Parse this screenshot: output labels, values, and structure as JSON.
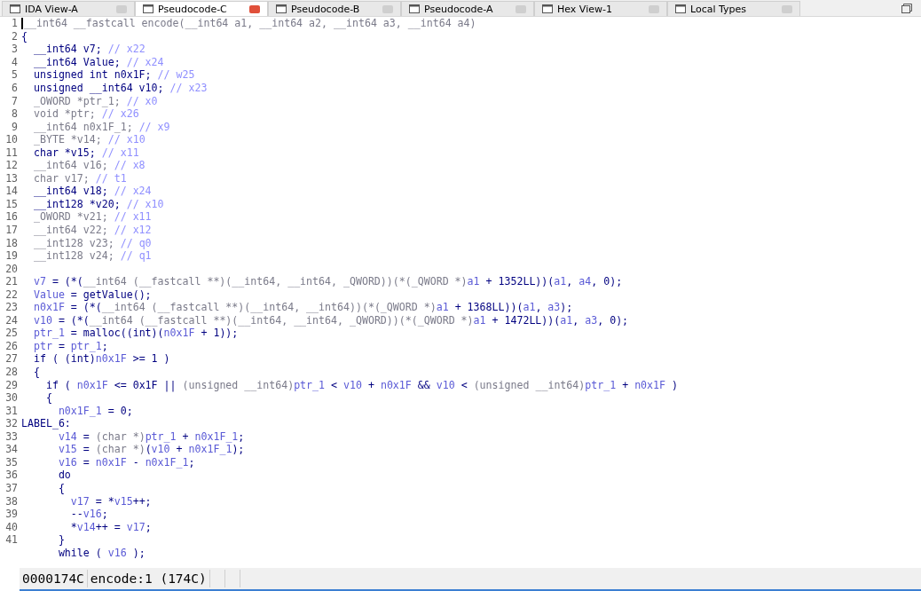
{
  "tabs": [
    {
      "label": "IDA View-A",
      "selected": false
    },
    {
      "label": "Pseudocode-C",
      "selected": true
    },
    {
      "label": "Pseudocode-B",
      "selected": false
    },
    {
      "label": "Pseudocode-A",
      "selected": false
    },
    {
      "label": "Hex View-1",
      "selected": false
    },
    {
      "label": "Local Types",
      "selected": false
    }
  ],
  "code_lines": [
    {
      "number": "1",
      "tokens": [
        {
          "text": "__int64 __fastcall encode(__int64 a1, __int64 a2, __int64 a3, __int64 a4)",
          "kind": "gray"
        }
      ]
    },
    {
      "number": "2",
      "tokens": [
        {
          "text": "{",
          "kind": "code"
        }
      ]
    },
    {
      "number": "3",
      "tokens": [
        {
          "text": "  __int64 v7; ",
          "kind": "code"
        },
        {
          "text": "// x22",
          "kind": "comment"
        }
      ]
    },
    {
      "number": "4",
      "tokens": [
        {
          "text": "  __int64 Value; ",
          "kind": "code"
        },
        {
          "text": "// x24",
          "kind": "comment"
        }
      ]
    },
    {
      "number": "5",
      "tokens": [
        {
          "text": "  unsigned int n0x1F; ",
          "kind": "code"
        },
        {
          "text": "// w25",
          "kind": "comment"
        }
      ]
    },
    {
      "number": "6",
      "tokens": [
        {
          "text": "  unsigned __int64 v10; ",
          "kind": "code"
        },
        {
          "text": "// x23",
          "kind": "comment"
        }
      ]
    },
    {
      "number": "7",
      "tokens": [
        {
          "text": "  _OWORD *ptr_1; ",
          "kind": "gray"
        },
        {
          "text": "// x0",
          "kind": "comment"
        }
      ]
    },
    {
      "number": "8",
      "tokens": [
        {
          "text": "  void *ptr; ",
          "kind": "gray"
        },
        {
          "text": "// x26",
          "kind": "comment"
        }
      ]
    },
    {
      "number": "9",
      "tokens": [
        {
          "text": "  __int64 n0x1F_1; ",
          "kind": "gray"
        },
        {
          "text": "// x9",
          "kind": "comment"
        }
      ]
    },
    {
      "number": "10",
      "tokens": [
        {
          "text": "  _BYTE *v14; ",
          "kind": "gray"
        },
        {
          "text": "// x10",
          "kind": "comment"
        }
      ]
    },
    {
      "number": "11",
      "tokens": [
        {
          "text": "  char *v15; ",
          "kind": "code"
        },
        {
          "text": "// x11",
          "kind": "comment"
        }
      ]
    },
    {
      "number": "12",
      "tokens": [
        {
          "text": "  __int64 v16; ",
          "kind": "gray"
        },
        {
          "text": "// x8",
          "kind": "comment"
        }
      ]
    },
    {
      "number": "13",
      "tokens": [
        {
          "text": "  char v17; ",
          "kind": "gray"
        },
        {
          "text": "// t1",
          "kind": "comment"
        }
      ]
    },
    {
      "number": "14",
      "tokens": [
        {
          "text": "  __int64 v18; ",
          "kind": "code"
        },
        {
          "text": "// x24",
          "kind": "comment"
        }
      ]
    },
    {
      "number": "15",
      "tokens": [
        {
          "text": "  __int128 *v20; ",
          "kind": "code"
        },
        {
          "text": "// x10",
          "kind": "comment"
        }
      ]
    },
    {
      "number": "16",
      "tokens": [
        {
          "text": "  _OWORD *v21; ",
          "kind": "gray"
        },
        {
          "text": "// x11",
          "kind": "comment"
        }
      ]
    },
    {
      "number": "17",
      "tokens": [
        {
          "text": "  __int64 v22; ",
          "kind": "gray"
        },
        {
          "text": "// x12",
          "kind": "comment"
        }
      ]
    },
    {
      "number": "18",
      "tokens": [
        {
          "text": "  __int128 v23; ",
          "kind": "gray"
        },
        {
          "text": "// q0",
          "kind": "comment"
        }
      ]
    },
    {
      "number": "19",
      "tokens": [
        {
          "text": "  __int128 v24; ",
          "kind": "gray"
        },
        {
          "text": "// q1",
          "kind": "comment"
        }
      ]
    },
    {
      "number": "20"
    },
    {
      "number": "21",
      "tokens": [
        {
          "text": "  v7",
          "kind": "var"
        },
        {
          "text": " = (*(",
          "kind": "code"
        },
        {
          "text": "__int64 (__fastcall **)(__int64, __int64, _QWORD))(*(_QWORD *)",
          "kind": "gray"
        },
        {
          "text": "a1",
          "kind": "var"
        },
        {
          "text": " + 1352LL))(",
          "kind": "code"
        },
        {
          "text": "a1",
          "kind": "var"
        },
        {
          "text": ", ",
          "kind": "code"
        },
        {
          "text": "a4",
          "kind": "var"
        },
        {
          "text": ", 0);",
          "kind": "code"
        }
      ]
    },
    {
      "number": "22",
      "tokens": [
        {
          "text": "  Value",
          "kind": "var"
        },
        {
          "text": " = getValue();",
          "kind": "code"
        }
      ]
    },
    {
      "number": "23",
      "tokens": [
        {
          "text": "  n0x1F",
          "kind": "var"
        },
        {
          "text": " = (*(",
          "kind": "code"
        },
        {
          "text": "__int64 (__fastcall **)(__int64, __int64))(*(_QWORD *)",
          "kind": "gray"
        },
        {
          "text": "a1",
          "kind": "var"
        },
        {
          "text": " + 1368LL))(",
          "kind": "code"
        },
        {
          "text": "a1",
          "kind": "var"
        },
        {
          "text": ", ",
          "kind": "code"
        },
        {
          "text": "a3",
          "kind": "var"
        },
        {
          "text": ");",
          "kind": "code"
        }
      ]
    },
    {
      "number": "24",
      "tokens": [
        {
          "text": "  v10",
          "kind": "var"
        },
        {
          "text": " = (*(",
          "kind": "code"
        },
        {
          "text": "__int64 (__fastcall **)(__int64, __int64, _QWORD))(*(_QWORD *)",
          "kind": "gray"
        },
        {
          "text": "a1",
          "kind": "var"
        },
        {
          "text": " + 1472LL))(",
          "kind": "code"
        },
        {
          "text": "a1",
          "kind": "var"
        },
        {
          "text": ", ",
          "kind": "code"
        },
        {
          "text": "a3",
          "kind": "var"
        },
        {
          "text": ", 0);",
          "kind": "code"
        }
      ]
    },
    {
      "number": "25",
      "tokens": [
        {
          "text": "  ptr_1",
          "kind": "var"
        },
        {
          "text": " = malloc((int)(",
          "kind": "code"
        },
        {
          "text": "n0x1F",
          "kind": "var"
        },
        {
          "text": " + 1));",
          "kind": "code"
        }
      ]
    },
    {
      "number": "26",
      "tokens": [
        {
          "text": "  ptr",
          "kind": "var"
        },
        {
          "text": " = ",
          "kind": "code"
        },
        {
          "text": "ptr_1",
          "kind": "var"
        },
        {
          "text": ";",
          "kind": "code"
        }
      ]
    },
    {
      "number": "27",
      "tokens": [
        {
          "text": "  if ( (int)",
          "kind": "code"
        },
        {
          "text": "n0x1F",
          "kind": "var"
        },
        {
          "text": " >= 1 )",
          "kind": "code"
        }
      ]
    },
    {
      "number": "28",
      "tokens": [
        {
          "text": "  {",
          "kind": "code"
        }
      ]
    },
    {
      "number": "29",
      "tokens": [
        {
          "text": "    if ( ",
          "kind": "code"
        },
        {
          "text": "n0x1F",
          "kind": "var"
        },
        {
          "text": " <= 0x1F || ",
          "kind": "code"
        },
        {
          "text": "(unsigned __int64)",
          "kind": "gray"
        },
        {
          "text": "ptr_1",
          "kind": "var"
        },
        {
          "text": " < ",
          "kind": "code"
        },
        {
          "text": "v10",
          "kind": "var"
        },
        {
          "text": " + ",
          "kind": "code"
        },
        {
          "text": "n0x1F",
          "kind": "var"
        },
        {
          "text": " && ",
          "kind": "code"
        },
        {
          "text": "v10",
          "kind": "var"
        },
        {
          "text": " < ",
          "kind": "code"
        },
        {
          "text": "(unsigned __int64)",
          "kind": "gray"
        },
        {
          "text": "ptr_1",
          "kind": "var"
        },
        {
          "text": " + ",
          "kind": "code"
        },
        {
          "text": "n0x1F",
          "kind": "var"
        },
        {
          "text": " )",
          "kind": "code"
        }
      ]
    },
    {
      "number": "30",
      "tokens": [
        {
          "text": "    {",
          "kind": "code"
        }
      ]
    },
    {
      "number": "31",
      "tokens": [
        {
          "text": "      n0x1F_1",
          "kind": "var"
        },
        {
          "text": " = 0;",
          "kind": "code"
        }
      ]
    },
    {
      "number": "32",
      "tokens": [
        {
          "text": "LABEL_6:",
          "kind": "code"
        }
      ]
    },
    {
      "number": "33",
      "tokens": [
        {
          "text": "      v14",
          "kind": "var"
        },
        {
          "text": " = ",
          "kind": "code"
        },
        {
          "text": "(char *)",
          "kind": "gray"
        },
        {
          "text": "ptr_1",
          "kind": "var"
        },
        {
          "text": " + ",
          "kind": "code"
        },
        {
          "text": "n0x1F_1",
          "kind": "var"
        },
        {
          "text": ";",
          "kind": "code"
        }
      ]
    },
    {
      "number": "34",
      "tokens": [
        {
          "text": "      v15",
          "kind": "var"
        },
        {
          "text": " = ",
          "kind": "code"
        },
        {
          "text": "(char *)",
          "kind": "gray"
        },
        {
          "text": "(",
          "kind": "code"
        },
        {
          "text": "v10",
          "kind": "var"
        },
        {
          "text": " + ",
          "kind": "code"
        },
        {
          "text": "n0x1F_1",
          "kind": "var"
        },
        {
          "text": ");",
          "kind": "code"
        }
      ]
    },
    {
      "number": "35",
      "tokens": [
        {
          "text": "      v16",
          "kind": "var"
        },
        {
          "text": " = ",
          "kind": "code"
        },
        {
          "text": "n0x1F",
          "kind": "var"
        },
        {
          "text": " - ",
          "kind": "code"
        },
        {
          "text": "n0x1F_1",
          "kind": "var"
        },
        {
          "text": ";",
          "kind": "code"
        }
      ]
    },
    {
      "number": "36",
      "tokens": [
        {
          "text": "      do",
          "kind": "code"
        }
      ]
    },
    {
      "number": "37",
      "tokens": [
        {
          "text": "      {",
          "kind": "code"
        }
      ]
    },
    {
      "number": "38",
      "tokens": [
        {
          "text": "        v17",
          "kind": "var"
        },
        {
          "text": " = *",
          "kind": "code"
        },
        {
          "text": "v15",
          "kind": "var"
        },
        {
          "text": "++;",
          "kind": "code"
        }
      ]
    },
    {
      "number": "39",
      "tokens": [
        {
          "text": "        --",
          "kind": "code"
        },
        {
          "text": "v16",
          "kind": "var"
        },
        {
          "text": ";",
          "kind": "code"
        }
      ]
    },
    {
      "number": "40",
      "tokens": [
        {
          "text": "        *",
          "kind": "code"
        },
        {
          "text": "v14",
          "kind": "var"
        },
        {
          "text": "++ = ",
          "kind": "code"
        },
        {
          "text": "v17",
          "kind": "var"
        },
        {
          "text": ";",
          "kind": "code"
        }
      ]
    },
    {
      "number": "41",
      "tokens": [
        {
          "text": "      }",
          "kind": "code"
        }
      ]
    },
    {
      "tokens": [
        {
          "text": "      while ( ",
          "kind": "code"
        },
        {
          "text": "v16",
          "kind": "var"
        },
        {
          "text": " );",
          "kind": "code"
        }
      ]
    }
  ],
  "status_bar": {
    "address": "0000174C",
    "location": "encode:1 (174C)"
  }
}
